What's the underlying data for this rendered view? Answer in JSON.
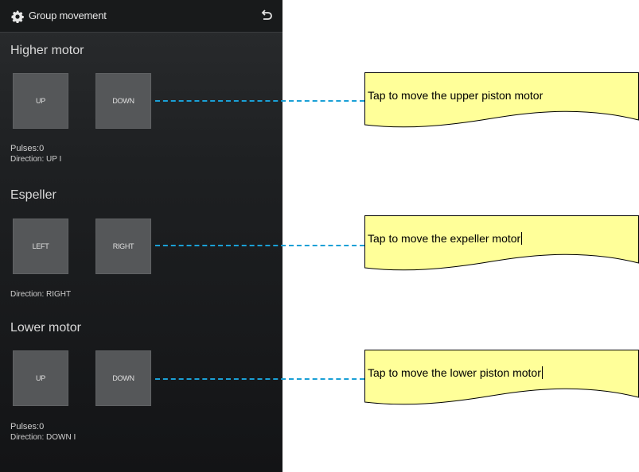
{
  "app": {
    "title": "Group movement"
  },
  "sections": [
    {
      "title": "Higher motor",
      "buttons": [
        "UP",
        "DOWN"
      ],
      "pulses": "Pulses:0",
      "direction": "Direction: UP I"
    },
    {
      "title": "Espeller",
      "buttons": [
        "LEFT",
        "RIGHT"
      ],
      "direction": "Direction: RIGHT"
    },
    {
      "title": "Lower motor",
      "buttons": [
        "UP",
        "DOWN"
      ],
      "pulses": "Pulses:0",
      "direction": "Direction: DOWN I"
    }
  ],
  "callouts": [
    "Tap to move the upper piston motor",
    "Tap to move the expeller motor",
    "Tap to move the lower piston motor"
  ],
  "colors": {
    "callout_fill": "#ffff99",
    "connector": "#1aa0d6",
    "button": "#555759"
  },
  "icons": {
    "settings": "gear-icon",
    "back": "back-icon"
  }
}
